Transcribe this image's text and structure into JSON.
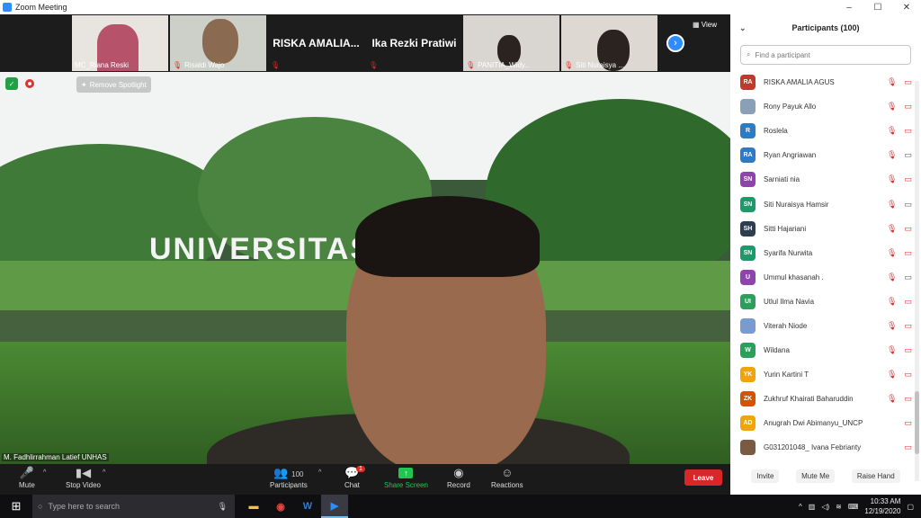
{
  "window": {
    "title": "Zoom Meeting",
    "controls": [
      "–",
      "☐",
      "✕"
    ]
  },
  "strip": {
    "tiles": [
      {
        "name": "MC_Riana Reski",
        "muted": false,
        "type": "video",
        "color": "#b6536b"
      },
      {
        "name": "Risaldi Wajo",
        "muted": true,
        "type": "video",
        "color": "#8a6a50"
      },
      {
        "name": "RISKA  AMALIA...",
        "muted": true,
        "type": "text"
      },
      {
        "name": "Ika Rezki Pratiwi",
        "muted": true,
        "type": "text"
      },
      {
        "name": "PANITIA_Widy...",
        "muted": true,
        "type": "video",
        "color": "#b9b0a6"
      },
      {
        "name": "Siti Nuraisya ...",
        "muted": true,
        "type": "video",
        "color": "#c3b8ae"
      }
    ],
    "view_label": "View",
    "next_icon": "›"
  },
  "main": {
    "speaker_name": "M. Fadhlirrahman Latief UNHAS",
    "sign_text": "UNIVERSITAS      IN",
    "remove_spotlight": "Remove Spotlight"
  },
  "toolbar": {
    "mute": "Mute",
    "stop_video": "Stop Video",
    "participants": "Participants",
    "participants_count": "100",
    "chat": "Chat",
    "chat_badge": "1",
    "share_screen": "Share Screen",
    "record": "Record",
    "reactions": "Reactions",
    "leave": "Leave"
  },
  "panel": {
    "title": "Participants (100)",
    "search_placeholder": "Find a participant",
    "participants": [
      {
        "initials": "RA",
        "name": "RISKA AMALIA AGUS",
        "color": "#c0392b",
        "mic_off": true,
        "cam_off": true
      },
      {
        "initials": "",
        "name": "Rony Payuk Allo",
        "color": "#8aa0b8",
        "mic_off": true,
        "cam_off": true
      },
      {
        "initials": "R",
        "name": "Roslela",
        "color": "#2d7bc4",
        "mic_off": true,
        "cam_off": true
      },
      {
        "initials": "RA",
        "name": "Ryan Angriawan",
        "color": "#2d7bc4",
        "mic_off": true,
        "cam_off": false
      },
      {
        "initials": "SN",
        "name": "Sarniati nia",
        "color": "#8e44ad",
        "mic_off": true,
        "cam_off": true
      },
      {
        "initials": "SN",
        "name": "Siti Nuraisya Hamsir",
        "color": "#1e9a6a",
        "mic_off": true,
        "cam_off": false
      },
      {
        "initials": "SH",
        "name": "Sitti Hajariani",
        "color": "#2c3e50",
        "mic_off": true,
        "cam_off": true
      },
      {
        "initials": "SN",
        "name": "Syarifa Nurwita",
        "color": "#1e9a6a",
        "mic_off": true,
        "cam_off": true
      },
      {
        "initials": "U",
        "name": "Ummul khasanah .",
        "color": "#8e44ad",
        "mic_off": true,
        "cam_off": false
      },
      {
        "initials": "UI",
        "name": "Utlul Ilma Navia",
        "color": "#2aa05a",
        "mic_off": true,
        "cam_off": true
      },
      {
        "initials": "",
        "name": "Viterah Niode",
        "color": "#7a9bd0",
        "mic_off": true,
        "cam_off": true
      },
      {
        "initials": "W",
        "name": "Wildana",
        "color": "#2aa05a",
        "mic_off": true,
        "cam_off": true
      },
      {
        "initials": "YK",
        "name": "Yurin Kartini T",
        "color": "#f0a30a",
        "mic_off": true,
        "cam_off": true
      },
      {
        "initials": "ZK",
        "name": "Zukhruf Khairati Baharuddin",
        "color": "#d35400",
        "mic_off": true,
        "cam_off": true
      },
      {
        "initials": "AD",
        "name": "Anugrah Dwi Abimanyu_UNCP",
        "color": "#f0a30a",
        "mic_off": false,
        "cam_off": true
      },
      {
        "initials": "",
        "name": "G031201048_ Ivana Febrianty",
        "color": "#7a5a40",
        "mic_off": false,
        "cam_off": true
      }
    ],
    "invite": "Invite",
    "mute_me": "Mute Me",
    "raise_hand": "Raise Hand"
  },
  "taskbar": {
    "search_placeholder": "Type here to search",
    "time": "10:33 AM",
    "date": "12/19/2020"
  }
}
